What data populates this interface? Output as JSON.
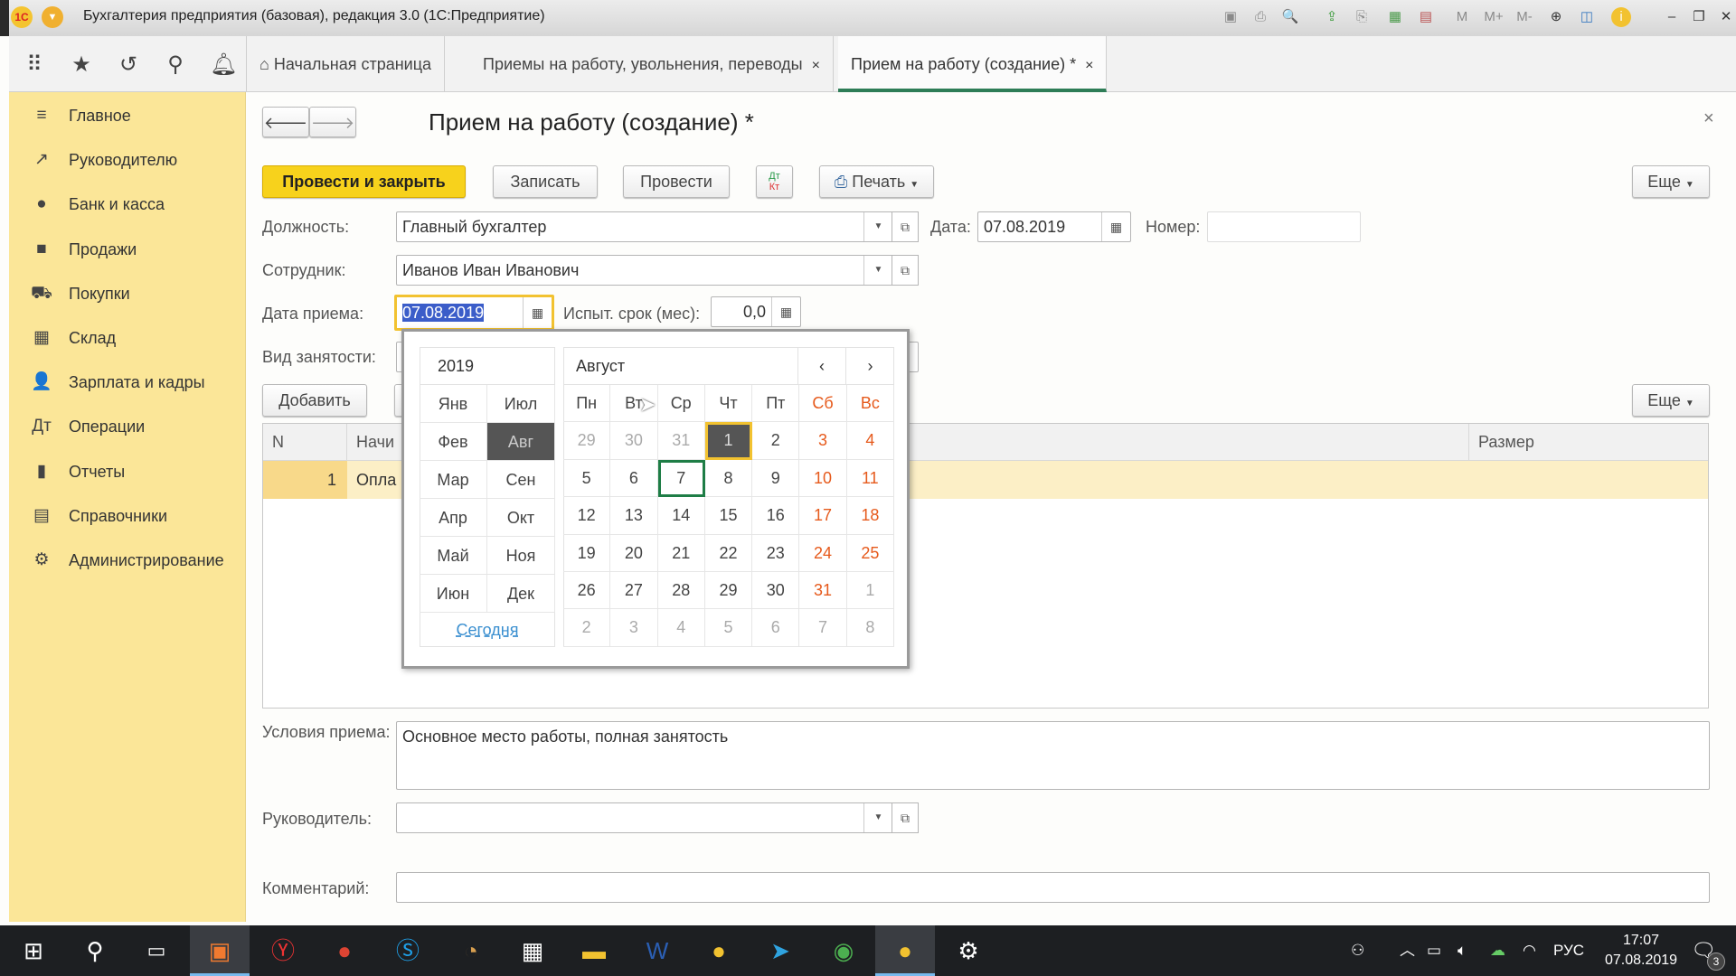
{
  "window": {
    "title": "Бухгалтерия предприятия (базовая), редакция 3.0  (1С:Предприятие)",
    "logo": "1С",
    "memory_buttons": [
      "M",
      "M+",
      "M-"
    ]
  },
  "tabs": [
    {
      "label": "Начальная страница"
    },
    {
      "label": "Приемы на работу, увольнения, переводы",
      "close": "×"
    },
    {
      "label": "Прием на работу (создание) *",
      "close": "×"
    }
  ],
  "sidebar": {
    "items": [
      {
        "label": "Главное",
        "icon": "≡"
      },
      {
        "label": "Руководителю",
        "icon": "↗"
      },
      {
        "label": "Банк и касса",
        "icon": "●"
      },
      {
        "label": "Продажи",
        "icon": "■"
      },
      {
        "label": "Покупки",
        "icon": "⛟"
      },
      {
        "label": "Склад",
        "icon": "▦"
      },
      {
        "label": "Зарплата и кадры",
        "icon": "👤"
      },
      {
        "label": "Операции",
        "icon": "Дт"
      },
      {
        "label": "Отчеты",
        "icon": "▮"
      },
      {
        "label": "Справочники",
        "icon": "▤"
      },
      {
        "label": "Администрирование",
        "icon": "⚙"
      }
    ]
  },
  "form": {
    "title": "Прием на работу (создание) *",
    "buttons": {
      "post_close": "Провести и закрыть",
      "save": "Записать",
      "post": "Провести",
      "dtkt_top": "Дт",
      "dtkt_bottom": "Кт",
      "print": "Печать",
      "more": "Еще"
    },
    "position_label": "Должность:",
    "position_value": "Главный бухгалтер",
    "date_label": "Дата:",
    "date_value": "07.08.2019",
    "number_label": "Номер:",
    "number_value": "",
    "employee_label": "Сотрудник:",
    "employee_value": "Иванов Иван Иванович",
    "hire_date_label": "Дата приема:",
    "hire_date_value": "07.08.2019",
    "probation_label": "Испыт. срок (мес):",
    "probation_value": "0,0",
    "employment_type_label": "Вид занятости:",
    "add_button": "Добавить",
    "more_button": "Еще",
    "table": {
      "headers": [
        "N",
        "Начи",
        "Размер"
      ],
      "rows": [
        {
          "n": "1",
          "name": "Опла"
        }
      ]
    },
    "conditions_label": "Условия приема:",
    "conditions_value": "Основное место работы, полная занятость",
    "manager_label": "Руководитель:",
    "manager_value": "",
    "comment_label": "Комментарий:",
    "comment_value": ""
  },
  "calendar": {
    "year": "2019",
    "month": "Август",
    "prev": "‹",
    "next": "›",
    "today_link": "Сегодня",
    "months_left": [
      "Янв",
      "Фев",
      "Мар",
      "Апр",
      "Май",
      "Июн"
    ],
    "months_right": [
      "Июл",
      "Авг",
      "Сен",
      "Окт",
      "Ноя",
      "Дек"
    ],
    "selected_month": "Авг",
    "weekdays": [
      "Пн",
      "Вт",
      "Ср",
      "Чт",
      "Пт",
      "Сб",
      "Вс"
    ],
    "days": [
      29,
      30,
      31,
      1,
      2,
      3,
      4,
      5,
      6,
      7,
      8,
      9,
      10,
      11,
      12,
      13,
      14,
      15,
      16,
      17,
      18,
      19,
      20,
      21,
      22,
      23,
      24,
      25,
      26,
      27,
      28,
      29,
      30,
      31,
      1,
      2,
      3,
      4,
      5,
      6,
      7,
      8
    ],
    "month_start_index": 3,
    "month_end_index": 33,
    "selected_index": 3,
    "today_index": 9
  },
  "taskbar": {
    "time": "17:07",
    "date": "07.08.2019",
    "lang": "РУС",
    "notifications": "3"
  }
}
